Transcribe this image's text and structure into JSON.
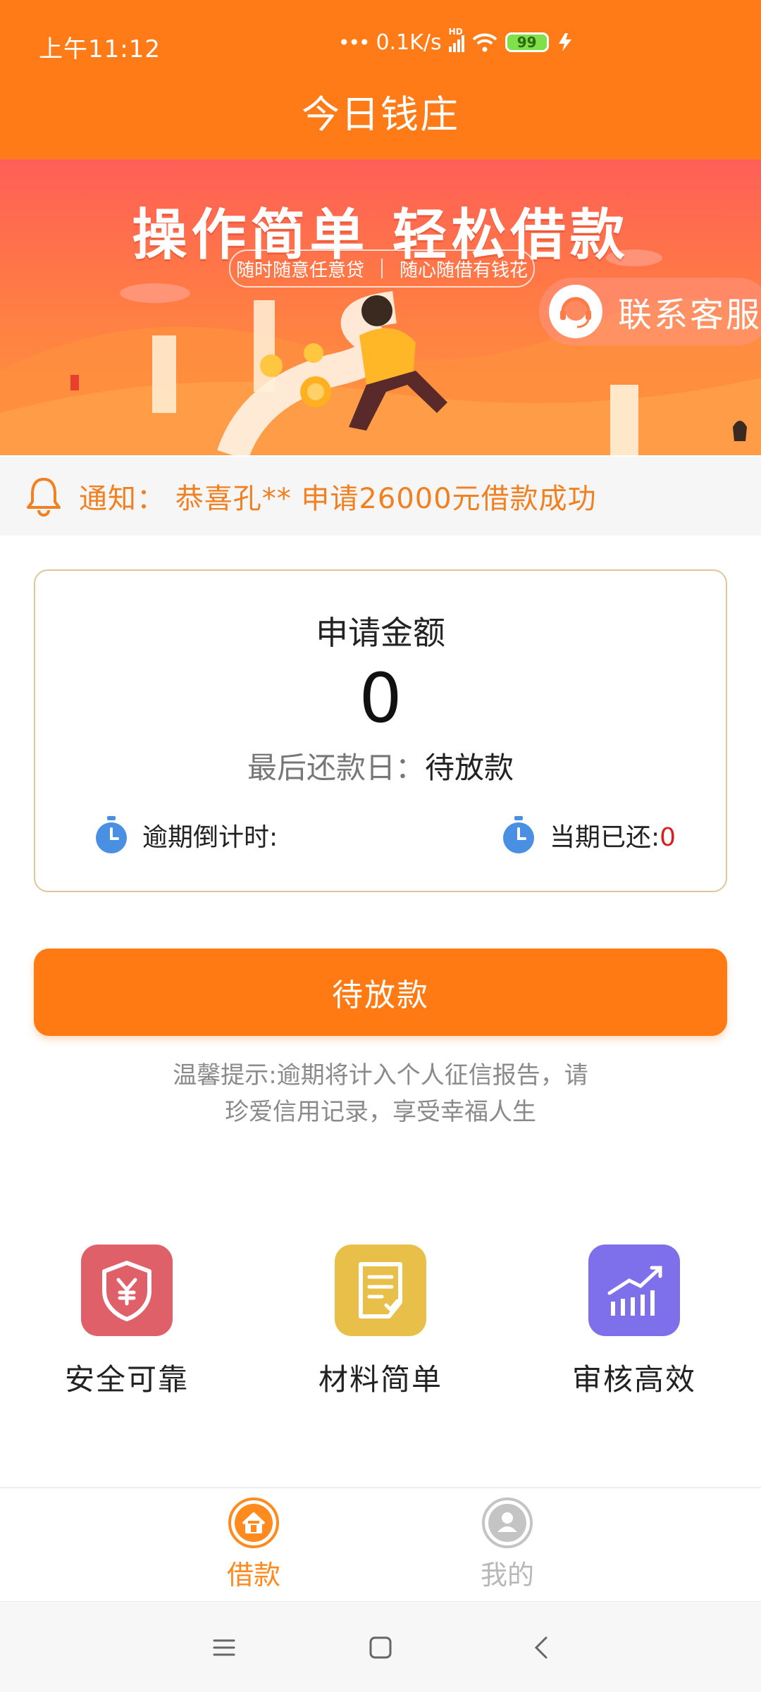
{
  "status_bar": {
    "time": "上午11:12",
    "network_speed": "0.1K/s",
    "network_badge": "HD",
    "battery": "99"
  },
  "header": {
    "title": "今日钱庄"
  },
  "banner": {
    "headline": "操作简单  轻松借款",
    "tag_left": "随时随意任意贷",
    "tag_right": "随心随借有钱花",
    "contact_label": "联系客服"
  },
  "notice": {
    "text": "通知：  恭喜孔** 申请26000元借款成功"
  },
  "loan_card": {
    "title": "申请金额",
    "amount": "0",
    "due_label": "最后还款日：",
    "due_value": "待放款",
    "countdown_label": "逾期倒计时:",
    "paid_label": "当期已还:",
    "paid_value": "0"
  },
  "primary_button": {
    "label": "待放款"
  },
  "tip": {
    "line1": "温馨提示:逾期将计入个人征信报告，请",
    "line2": "珍爱信用记录，享受幸福人生"
  },
  "features": [
    {
      "label": "安全可靠",
      "icon": "shield-yen-icon",
      "color": "#e0606a"
    },
    {
      "label": "材料简单",
      "icon": "document-check-icon",
      "color": "#e8bf48"
    },
    {
      "label": "审核高效",
      "icon": "chart-up-icon",
      "color": "#7d70ea"
    }
  ],
  "tabbar": {
    "items": [
      {
        "label": "借款",
        "icon": "home-icon",
        "active": true
      },
      {
        "label": "我的",
        "icon": "user-icon",
        "active": false
      }
    ],
    "active_color": "#ff8a1e",
    "inactive_color": "#b8b8b8"
  },
  "theme": {
    "primary": "#ff7b18",
    "notice_text": "#f08020",
    "highlight_red": "#d82020"
  }
}
